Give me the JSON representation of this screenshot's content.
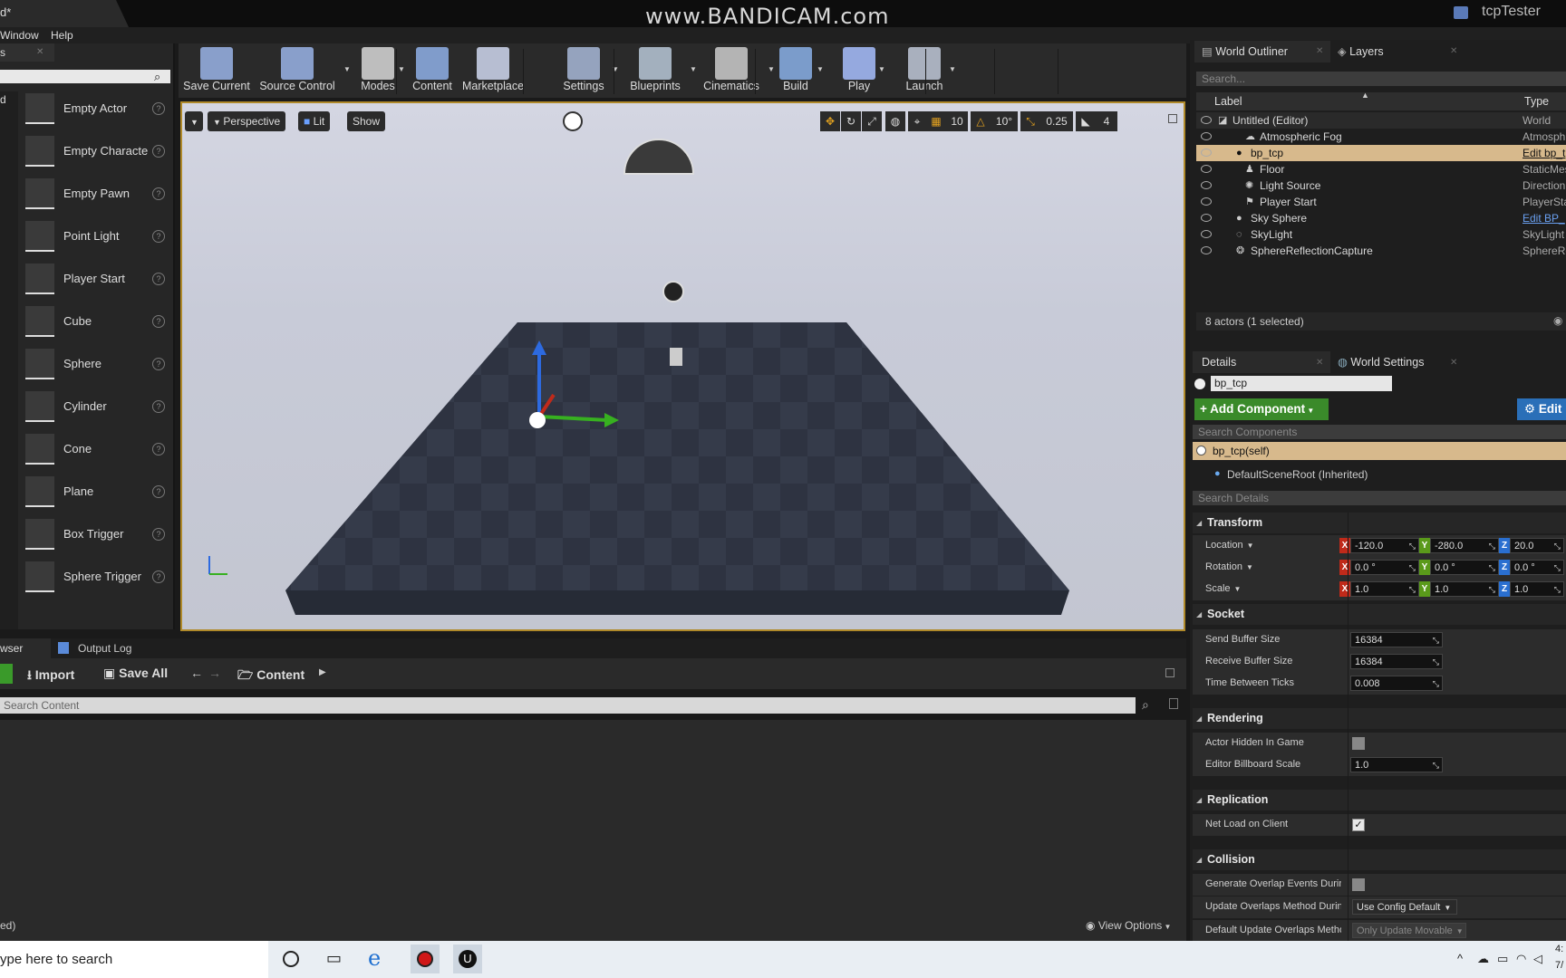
{
  "window": {
    "title_fragment": "d*",
    "watermark": "www.BANDICAM.com",
    "project": "tcpTester"
  },
  "menu": {
    "items": [
      "Window",
      "Help"
    ]
  },
  "place_panel": {
    "tab_fragment": "s",
    "category_fragment": "d",
    "items": [
      "Empty Actor",
      "Empty Characte",
      "Empty Pawn",
      "Point Light",
      "Player Start",
      "Cube",
      "Sphere",
      "Cylinder",
      "Cone",
      "Plane",
      "Box Trigger",
      "Sphere Trigger"
    ]
  },
  "toolbar": {
    "buttons": [
      "Save Current",
      "Source Control",
      "Modes",
      "Content",
      "Marketplace",
      "Settings",
      "Blueprints",
      "Cinematics",
      "Build",
      "Play",
      "Launch"
    ]
  },
  "viewport": {
    "perspective": "Perspective",
    "lit": "Lit",
    "show": "Show",
    "grid_snap": "10",
    "rot_snap": "10°",
    "scale_snap": "0.25",
    "camera_speed": "4"
  },
  "content_browser": {
    "tab_fragment": "wser",
    "output_log_tab": "Output Log",
    "import": "Import",
    "save_all": "Save All",
    "path": "Content",
    "search_placeholder": "Search Content",
    "status_fragment": "ed)",
    "view_options": "View Options"
  },
  "outliner": {
    "tab": "World Outliner",
    "layers_tab": "Layers",
    "search_placeholder": "Search...",
    "col_label": "Label",
    "col_type": "Type",
    "rows": [
      {
        "name": "Untitled (Editor)",
        "type": "World"
      },
      {
        "name": "Atmospheric Fog",
        "type": "Atmosphi"
      },
      {
        "name": "bp_tcp",
        "type": "Edit bp_t"
      },
      {
        "name": "Floor",
        "type": "StaticMes"
      },
      {
        "name": "Light Source",
        "type": "Direction"
      },
      {
        "name": "Player Start",
        "type": "PlayerSta"
      },
      {
        "name": "Sky Sphere",
        "type": "Edit BP_"
      },
      {
        "name": "SkyLight",
        "type": "SkyLight"
      },
      {
        "name": "SphereReflectionCapture",
        "type": "SphereRe"
      }
    ],
    "status": "8 actors (1 selected)"
  },
  "details": {
    "tab": "Details",
    "world_settings_tab": "World Settings",
    "actor_name": "bp_tcp",
    "add_component": "+ Add Component",
    "edit_blueprint": "Edit",
    "search_components": "Search Components",
    "self_component": "bp_tcp(self)",
    "root_component": "DefaultSceneRoot (Inherited)",
    "search_details": "Search Details",
    "transform": {
      "title": "Transform",
      "location_label": "Location",
      "rotation_label": "Rotation",
      "scale_label": "Scale",
      "location": [
        "-120.0",
        "-280.0",
        "20.0"
      ],
      "rotation": [
        "0.0 °",
        "0.0 °",
        "0.0 °"
      ],
      "scale": [
        "1.0",
        "1.0",
        "1.0"
      ]
    },
    "socket": {
      "title": "Socket",
      "send_label": "Send Buffer Size",
      "send": "16384",
      "recv_label": "Receive Buffer Size",
      "recv": "16384",
      "ticks_label": "Time Between Ticks",
      "ticks": "0.008"
    },
    "rendering": {
      "title": "Rendering",
      "hidden_label": "Actor Hidden In Game",
      "billboard_label": "Editor Billboard Scale",
      "billboard": "1.0"
    },
    "replication": {
      "title": "Replication",
      "net_load_label": "Net Load on Client"
    },
    "collision": {
      "title": "Collision",
      "overlap_label": "Generate Overlap Events During",
      "update_label": "Update Overlaps Method During",
      "update_value": "Use Config Default",
      "default_label": "Default Update Overlaps Metho",
      "default_value": "Only Update Movable"
    }
  },
  "taskbar": {
    "search": "ype here to search",
    "clock_fragment": "4:",
    "date_fragment": "7/"
  },
  "colors": {
    "selection": "#d7b98c",
    "viewport_border": "#b08a2a",
    "add_component": "#3a8a2a",
    "edit_blue": "#2a6fb8"
  }
}
